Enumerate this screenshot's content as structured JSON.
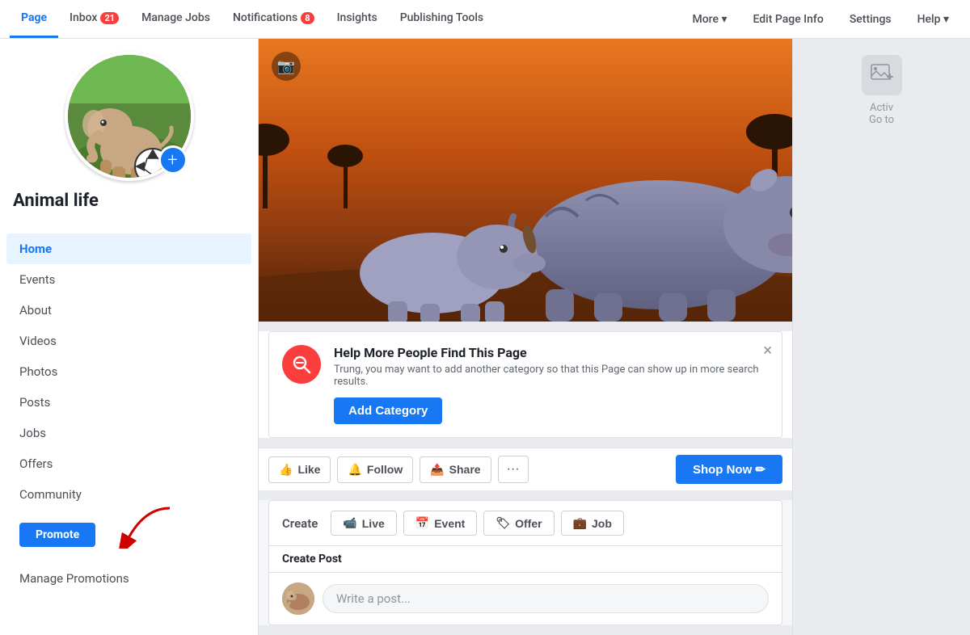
{
  "nav": {
    "items": [
      {
        "label": "Page",
        "active": true,
        "badge": null
      },
      {
        "label": "Inbox",
        "active": false,
        "badge": "21"
      },
      {
        "label": "Manage Jobs",
        "active": false,
        "badge": null
      },
      {
        "label": "Notifications",
        "active": false,
        "badge": "8"
      },
      {
        "label": "Insights",
        "active": false,
        "badge": null
      },
      {
        "label": "Publishing Tools",
        "active": false,
        "badge": null
      }
    ],
    "right_items": [
      {
        "label": "More ▾"
      },
      {
        "label": "Edit Page Info"
      },
      {
        "label": "Settings"
      },
      {
        "label": "Help ▾"
      }
    ]
  },
  "sidebar": {
    "page_name": "Animal life",
    "nav_items": [
      {
        "label": "Home",
        "active": true
      },
      {
        "label": "Events",
        "active": false
      },
      {
        "label": "About",
        "active": false
      },
      {
        "label": "Videos",
        "active": false
      },
      {
        "label": "Photos",
        "active": false
      },
      {
        "label": "Posts",
        "active": false
      },
      {
        "label": "Jobs",
        "active": false
      },
      {
        "label": "Offers",
        "active": false
      },
      {
        "label": "Community",
        "active": false
      }
    ],
    "promote_label": "Promote",
    "manage_promos_label": "Manage Promotions"
  },
  "notification_banner": {
    "title": "Help More People Find This Page",
    "description": "Trung, you may want to add another category so that this Page can show up in more search results.",
    "button_label": "Add Category",
    "icon": "🔍",
    "close": "×"
  },
  "action_bar": {
    "like_label": "Like",
    "follow_label": "Follow",
    "share_label": "Share",
    "dots": "···",
    "shop_now_label": "Shop Now ✏"
  },
  "create_area": {
    "label": "Create",
    "live_label": "Live",
    "event_label": "Event",
    "offer_label": "Offer",
    "job_label": "Job",
    "post_placeholder": "Write a post..."
  },
  "create_post": {
    "label": "Create Post"
  },
  "right_panel": {
    "text_1": "Activ",
    "text_2": "Go to"
  }
}
